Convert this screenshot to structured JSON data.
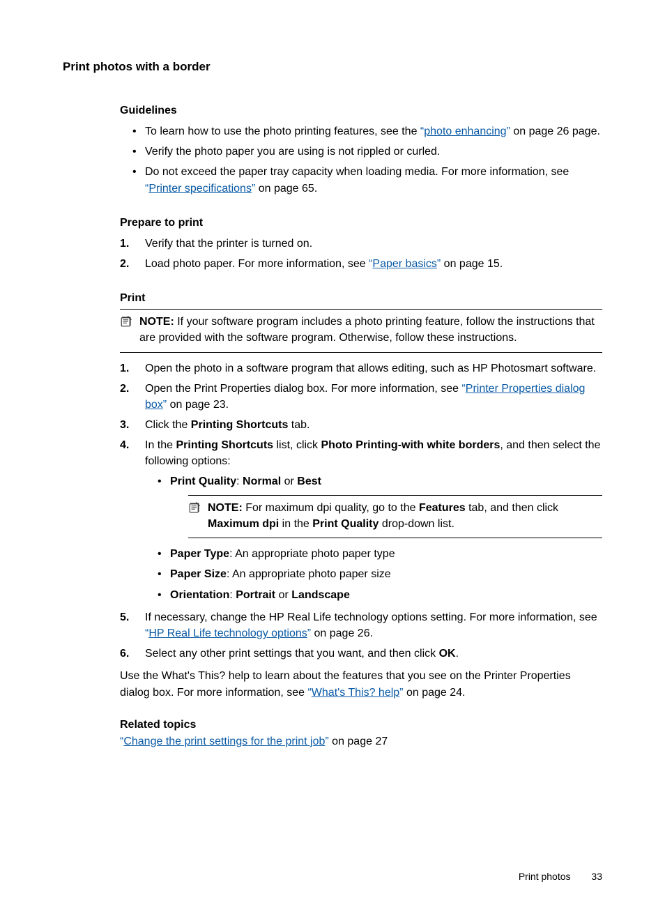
{
  "page_title": "Print photos with a border",
  "guidelines": {
    "heading": "Guidelines",
    "item1_pre": "To learn how to use the photo printing features, see the ",
    "item1_lq": "“",
    "item1_link": "photo enhancing",
    "item1_rq": "”",
    "item1_post": " on page 26 page.",
    "item2": "Verify the photo paper you are using is not rippled or curled.",
    "item3_pre": "Do not exceed the paper tray capacity when loading media. For more information, see ",
    "item3_lq": "“",
    "item3_link": "Printer specifications",
    "item3_rq": "”",
    "item3_post": " on page 65."
  },
  "prepare": {
    "heading": "Prepare to print",
    "n1": "1.",
    "n2": "2.",
    "item1": "Verify that the printer is turned on.",
    "item2_pre": "Load photo paper. For more information, see ",
    "item2_lq": "“",
    "item2_link": "Paper basics",
    "item2_rq": "”",
    "item2_post": " on page 15."
  },
  "print": {
    "heading": "Print",
    "note_label": "NOTE:",
    "note_text": "If your software program includes a photo printing feature, follow the instructions that are provided with the software program. Otherwise, follow these instructions.",
    "n1": "1.",
    "n2": "2.",
    "n3": "3.",
    "n4": "4.",
    "n5": "5.",
    "n6": "6.",
    "s1": "Open the photo in a software program that allows editing, such as HP Photosmart software.",
    "s2_pre": "Open the Print Properties dialog box. For more information, see ",
    "s2_lq": "“",
    "s2_link": "Printer Properties dialog box",
    "s2_rq": "”",
    "s2_post": " on page 23.",
    "s3_pre": "Click the ",
    "s3_b": "Printing Shortcuts",
    "s3_post": " tab.",
    "s4_pre": "In the ",
    "s4_b1": "Printing Shortcuts",
    "s4_mid": " list, click ",
    "s4_b2": "Photo Printing-with white borders",
    "s4_post": ", and then select the following options:",
    "sub_pq_pre": "Print Quality",
    "sub_pq_mid": ": ",
    "sub_pq_b1": "Normal",
    "sub_pq_or": " or ",
    "sub_pq_b2": "Best",
    "subnote_label": "NOTE:",
    "subnote_pre": "For maximum dpi quality, go to the ",
    "subnote_b1": "Features",
    "subnote_mid": " tab, and then click ",
    "subnote_b2": "Maximum dpi",
    "subnote_mid2": " in the ",
    "subnote_b3": "Print Quality",
    "subnote_post": " drop-down list.",
    "sub_pt_b": "Paper Type",
    "sub_pt_post": ": An appropriate photo paper type",
    "sub_ps_b": "Paper Size",
    "sub_ps_post": ": An appropriate photo paper size",
    "sub_or_b": "Orientation",
    "sub_or_mid": ": ",
    "sub_or_b1": "Portrait",
    "sub_or_or": " or ",
    "sub_or_b2": "Landscape",
    "s5_pre": "If necessary, change the HP Real Life technology options setting. For more information, see ",
    "s5_lq": "“",
    "s5_link": "HP Real Life technology options",
    "s5_rq": "”",
    "s5_post": " on page 26.",
    "s6_pre": "Select any other print settings that you want, and then click ",
    "s6_b": "OK",
    "s6_post": ".",
    "closing_pre": "Use the What's This? help to learn about the features that you see on the Printer Properties dialog box. For more information, see ",
    "closing_lq": "“",
    "closing_link": "What's This? help",
    "closing_rq": "”",
    "closing_post": " on page 24."
  },
  "related": {
    "heading": "Related topics",
    "lq": "“",
    "link": "Change the print settings for the print job",
    "rq": "”",
    "post": " on page 27"
  },
  "footer": {
    "section": "Print photos",
    "page": "33"
  }
}
